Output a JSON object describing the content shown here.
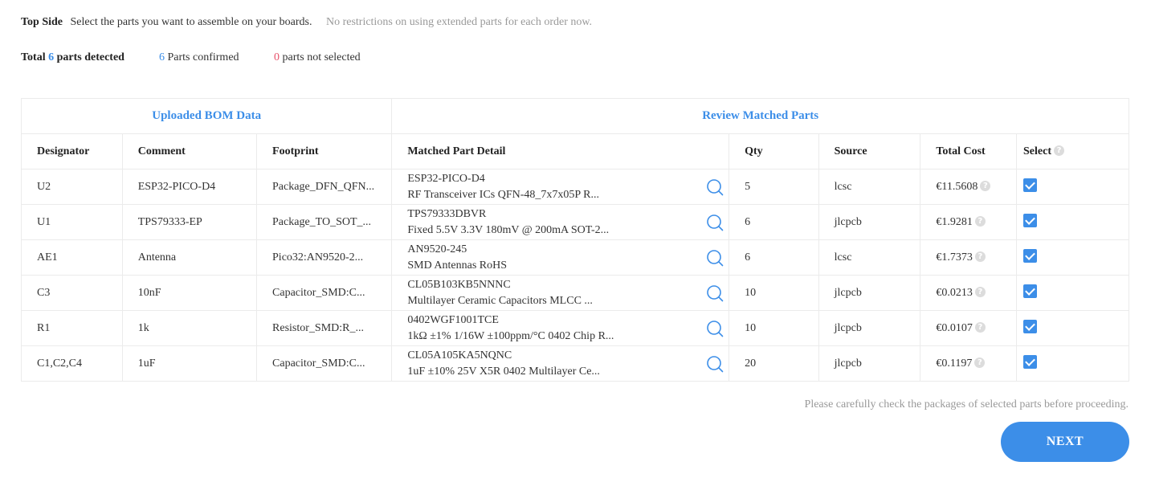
{
  "header": {
    "side_label": "Top Side",
    "instruction": "Select the parts you want to assemble on your boards.",
    "note": "No restrictions on using extended parts for each order now."
  },
  "summary": {
    "total_prefix": "Total",
    "total_count": "6",
    "total_suffix": "parts detected",
    "confirmed_count": "6",
    "confirmed_label": "Parts confirmed",
    "not_selected_count": "0",
    "not_selected_label": "parts not selected"
  },
  "table": {
    "group_uploaded": "Uploaded BOM Data",
    "group_review": "Review Matched Parts",
    "columns": {
      "designator": "Designator",
      "comment": "Comment",
      "footprint": "Footprint",
      "matched": "Matched Part Detail",
      "qty": "Qty",
      "source": "Source",
      "total_cost": "Total Cost",
      "select": "Select"
    },
    "rows": [
      {
        "designator": "U2",
        "comment": "ESP32-PICO-D4",
        "footprint": "Package_DFN_QFN...",
        "part": "ESP32-PICO-D4",
        "desc": "RF Transceiver ICs QFN-48_7x7x05P R...",
        "qty": "5",
        "source": "lcsc",
        "cost": "€11.5608",
        "selected": true
      },
      {
        "designator": "U1",
        "comment": "TPS79333-EP",
        "footprint": "Package_TO_SOT_...",
        "part": "TPS79333DBVR",
        "desc": "Fixed 5.5V 3.3V 180mV @ 200mA SOT-2...",
        "qty": "6",
        "source": "jlcpcb",
        "cost": "€1.9281",
        "selected": true
      },
      {
        "designator": "AE1",
        "comment": "Antenna",
        "footprint": "Pico32:AN9520-2...",
        "part": "AN9520-245",
        "desc": "SMD Antennas RoHS",
        "qty": "6",
        "source": "lcsc",
        "cost": "€1.7373",
        "selected": true
      },
      {
        "designator": "C3",
        "comment": "10nF",
        "footprint": "Capacitor_SMD:C...",
        "part": "CL05B103KB5NNNC",
        "desc": "Multilayer Ceramic Capacitors MLCC ...",
        "qty": "10",
        "source": "jlcpcb",
        "cost": "€0.0213",
        "selected": true
      },
      {
        "designator": "R1",
        "comment": "1k",
        "footprint": "Resistor_SMD:R_...",
        "part": "0402WGF1001TCE",
        "desc": "1kΩ ±1% 1/16W ±100ppm/°C 0402 Chip R...",
        "qty": "10",
        "source": "jlcpcb",
        "cost": "€0.0107",
        "selected": true
      },
      {
        "designator": "C1,C2,C4",
        "comment": "1uF",
        "footprint": "Capacitor_SMD:C...",
        "part": "CL05A105KA5NQNC",
        "desc": "1uF ±10% 25V X5R 0402 Multilayer Ce...",
        "qty": "20",
        "source": "jlcpcb",
        "cost": "€0.1197",
        "selected": true
      }
    ]
  },
  "footer": {
    "warning": "Please carefully check the packages of selected parts before proceeding.",
    "next_label": "NEXT"
  },
  "colors": {
    "accent": "#3c8ee8",
    "alert": "#e8526b"
  },
  "icons": {
    "search": "search-icon",
    "help": "help-icon",
    "checkbox": "checkbox-checked-icon"
  }
}
